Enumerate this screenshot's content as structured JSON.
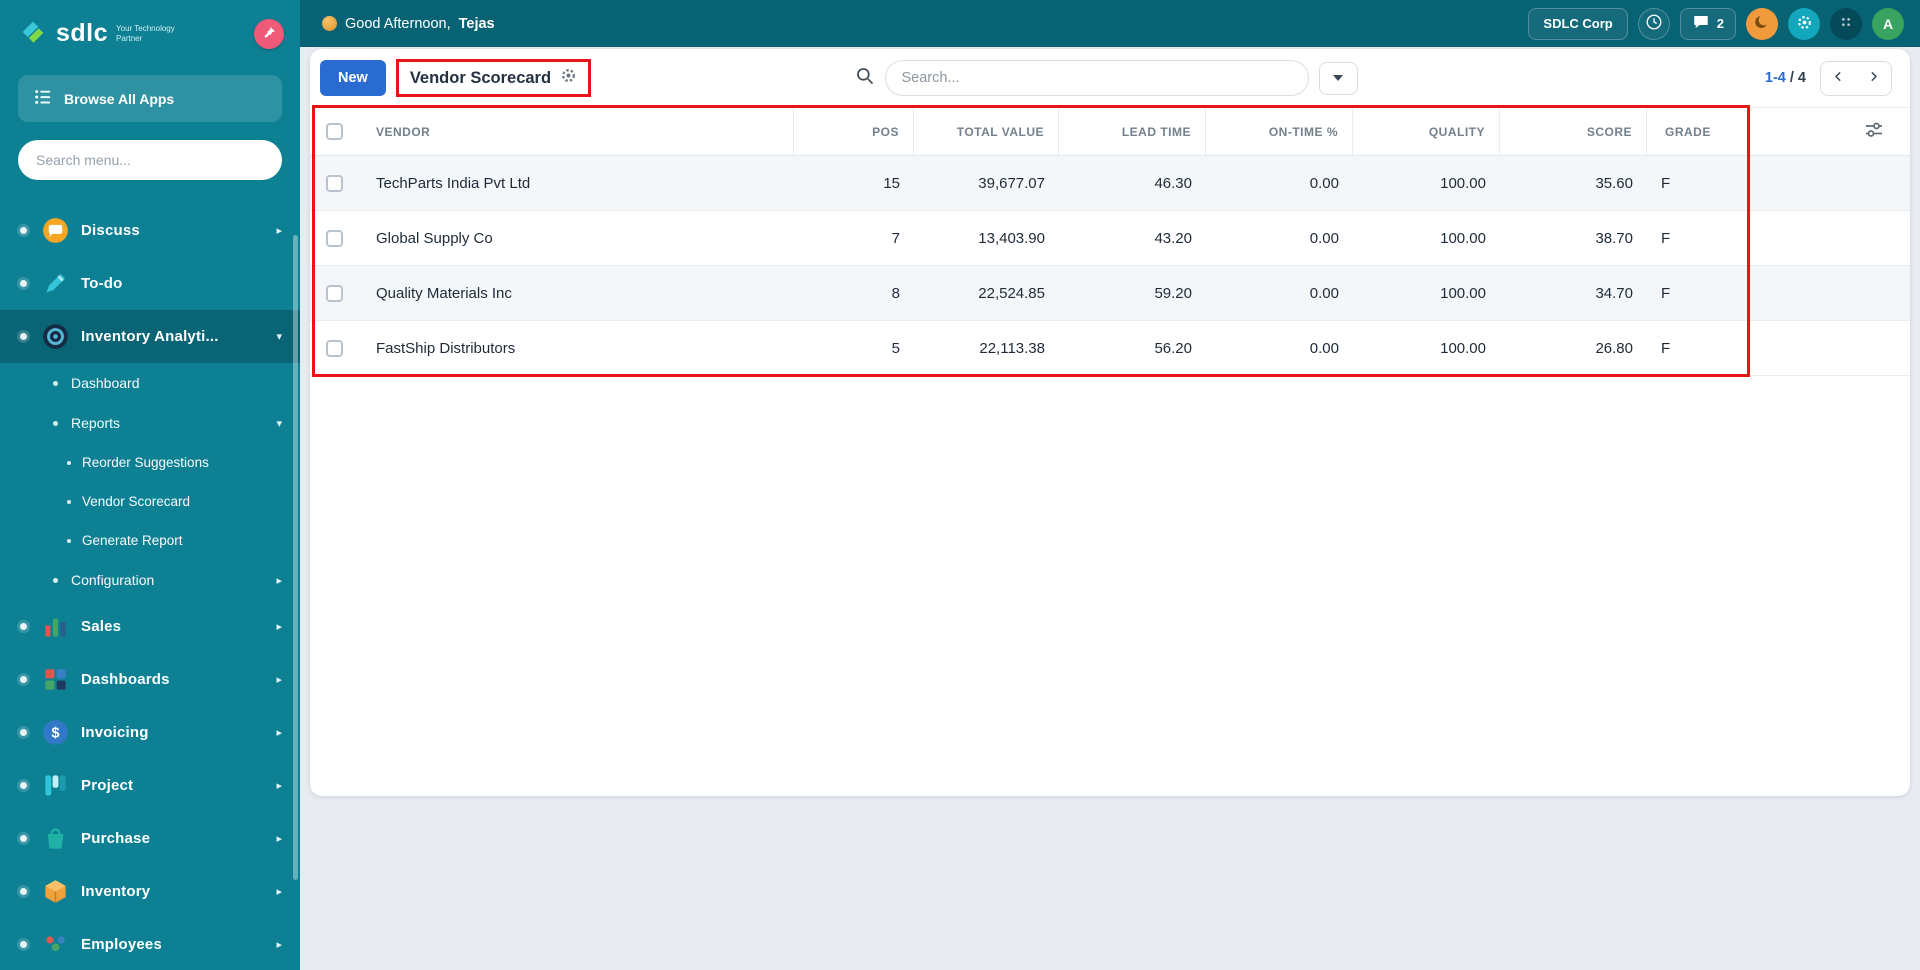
{
  "colors": {
    "sidebar_teal": "#0d8094",
    "topbar_teal": "#076273",
    "accent_blue": "#2a6bd2",
    "annotation_red": "#e81418",
    "avatar_green": "#3aa35f",
    "moon_orange": "#f09a3c",
    "gear_teal": "#13a7bd",
    "pin_pink": "#ee5a77"
  },
  "icons": {
    "sidebar": [
      "pin-icon",
      "apps-list-icon",
      "discuss-icon",
      "todo-icon",
      "inventory-analytics-icon",
      "sales-icon",
      "dashboards-icon",
      "invoicing-icon",
      "project-icon",
      "purchase-icon",
      "inventory-icon",
      "employees-icon"
    ],
    "topbar": [
      "wave-emoji-icon",
      "clock-icon",
      "chat-icon",
      "moon-icon",
      "gear-icon",
      "apps-launcher-icon"
    ],
    "controls": [
      "search-icon",
      "cog-icon",
      "caret-down-icon",
      "chevron-left-icon",
      "chevron-right-icon",
      "filter-sliders-icon"
    ]
  },
  "sidebar": {
    "logo": {
      "name": "sdlc",
      "tagline": "Your Technology Partner"
    },
    "browse_all_apps": "Browse All Apps",
    "search_placeholder": "Search menu...",
    "items": [
      {
        "label": "Discuss"
      },
      {
        "label": "To-do"
      },
      {
        "label": "Inventory Analyti...",
        "children": [
          {
            "label": "Dashboard"
          },
          {
            "label": "Reports",
            "children": [
              {
                "label": "Reorder Suggestions"
              },
              {
                "label": "Vendor Scorecard"
              },
              {
                "label": "Generate Report"
              }
            ]
          },
          {
            "label": "Configuration"
          }
        ]
      },
      {
        "label": "Sales"
      },
      {
        "label": "Dashboards"
      },
      {
        "label": "Invoicing"
      },
      {
        "label": "Project"
      },
      {
        "label": "Purchase"
      },
      {
        "label": "Inventory"
      },
      {
        "label": "Employees"
      }
    ]
  },
  "topbar": {
    "greeting": "Good Afternoon,",
    "user_name": "Tejas",
    "company": "SDLC Corp",
    "message_count": "2",
    "avatar_initial": "A"
  },
  "controls": {
    "new_button": "New",
    "view_title": "Vendor Scorecard",
    "search_placeholder": "Search...",
    "pager_range": "1-4",
    "pager_total": "/ 4"
  },
  "table": {
    "columns": [
      "VENDOR",
      "POS",
      "TOTAL VALUE",
      "LEAD TIME",
      "ON-TIME %",
      "QUALITY",
      "SCORE",
      "GRADE"
    ],
    "rows": [
      {
        "vendor": "TechParts India Pvt Ltd",
        "pos": "15",
        "total_value": "39,677.07",
        "lead_time": "46.30",
        "on_time_pct": "0.00",
        "quality": "100.00",
        "score": "35.60",
        "grade": "F"
      },
      {
        "vendor": "Global Supply Co",
        "pos": "7",
        "total_value": "13,403.90",
        "lead_time": "43.20",
        "on_time_pct": "0.00",
        "quality": "100.00",
        "score": "38.70",
        "grade": "F"
      },
      {
        "vendor": "Quality Materials Inc",
        "pos": "8",
        "total_value": "22,524.85",
        "lead_time": "59.20",
        "on_time_pct": "0.00",
        "quality": "100.00",
        "score": "34.70",
        "grade": "F"
      },
      {
        "vendor": "FastShip Distributors",
        "pos": "5",
        "total_value": "22,113.38",
        "lead_time": "56.20",
        "on_time_pct": "0.00",
        "quality": "100.00",
        "score": "26.80",
        "grade": "F"
      }
    ]
  }
}
